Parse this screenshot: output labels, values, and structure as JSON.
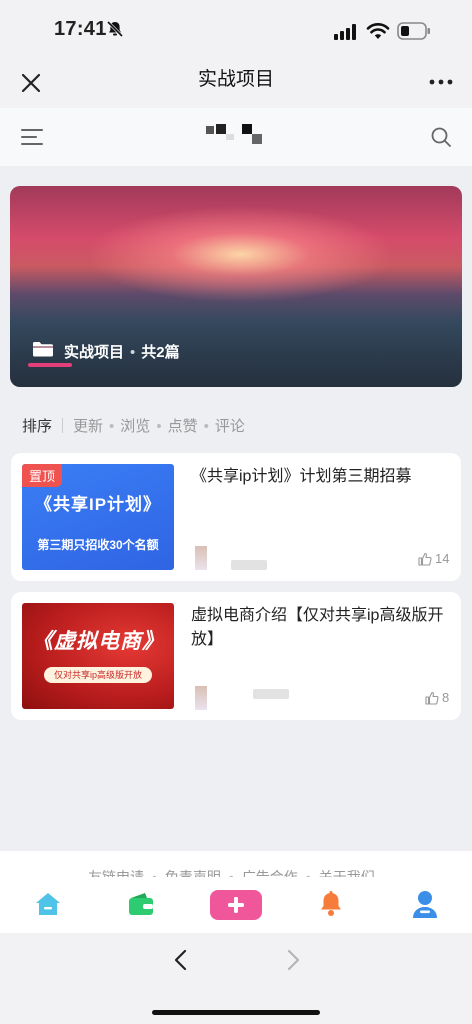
{
  "status_bar": {
    "time": "17:41"
  },
  "titlebar": {
    "title": "实战项目"
  },
  "hero": {
    "category": "实战项目",
    "count_text": "共2篇"
  },
  "sort": {
    "label": "排序",
    "options": [
      "更新",
      "浏览",
      "点赞",
      "评论"
    ]
  },
  "articles": [
    {
      "title": "《共享ip计划》计划第三期招募",
      "badge": "置顶",
      "thumb_main": "《共享IP计划》",
      "thumb_sub": "第三期只招收30个名额",
      "likes": "14"
    },
    {
      "title": "虚拟电商介绍【仅对共享ip高级版开放】",
      "thumb_main": "《虚拟电商》",
      "thumb_sub": "仅对共享ip高级版开放",
      "likes": "8"
    }
  ],
  "footer": {
    "links": [
      "友链申请",
      "免责声明",
      "广告合作",
      "关于我们"
    ]
  },
  "tabs": [
    {
      "name": "home-icon",
      "color": "#4fc3e8"
    },
    {
      "name": "wallet-icon",
      "color": "#2ecc71"
    },
    {
      "name": "add-icon",
      "color": "#f0569a"
    },
    {
      "name": "bell-icon",
      "color": "#f57c3a"
    },
    {
      "name": "user-icon",
      "color": "#3b8fe8"
    }
  ]
}
